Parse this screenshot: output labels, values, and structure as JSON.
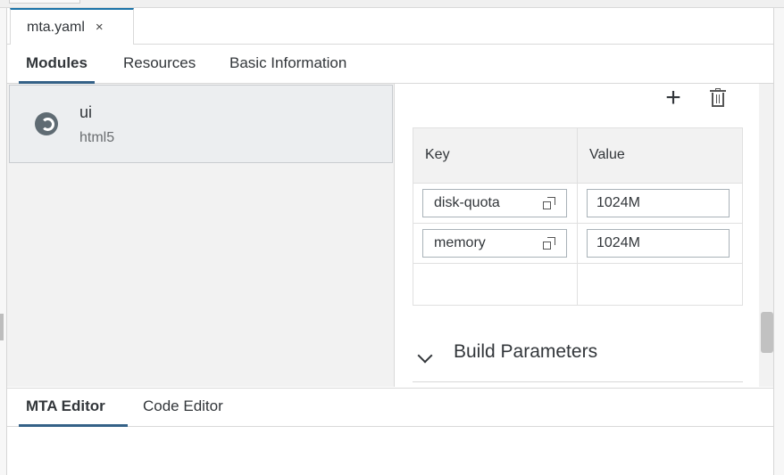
{
  "file_tab": {
    "label": "mta.yaml",
    "close_glyph": "×"
  },
  "tabs": [
    {
      "label": "Modules",
      "active": true
    },
    {
      "label": "Resources",
      "active": false
    },
    {
      "label": "Basic Information",
      "active": false
    }
  ],
  "modules": [
    {
      "name": "ui",
      "type": "html5",
      "icon": "module-icon"
    }
  ],
  "toolbar": {
    "add_glyph": "+",
    "add_icon": "plus-icon",
    "delete_icon": "trash-icon"
  },
  "properties": {
    "columns": [
      "Key",
      "Value"
    ],
    "rows": [
      {
        "key": "disk-quota",
        "value": "1024M"
      },
      {
        "key": "memory",
        "value": "1024M"
      }
    ]
  },
  "section": {
    "title": "Build Parameters",
    "icon": "chevron-down-icon"
  },
  "bottom_tabs": [
    {
      "label": "MTA Editor",
      "active": true
    },
    {
      "label": "Code Editor",
      "active": false
    }
  ],
  "colors": {
    "accent": "#346187",
    "tab_top": "#1a73a8"
  }
}
